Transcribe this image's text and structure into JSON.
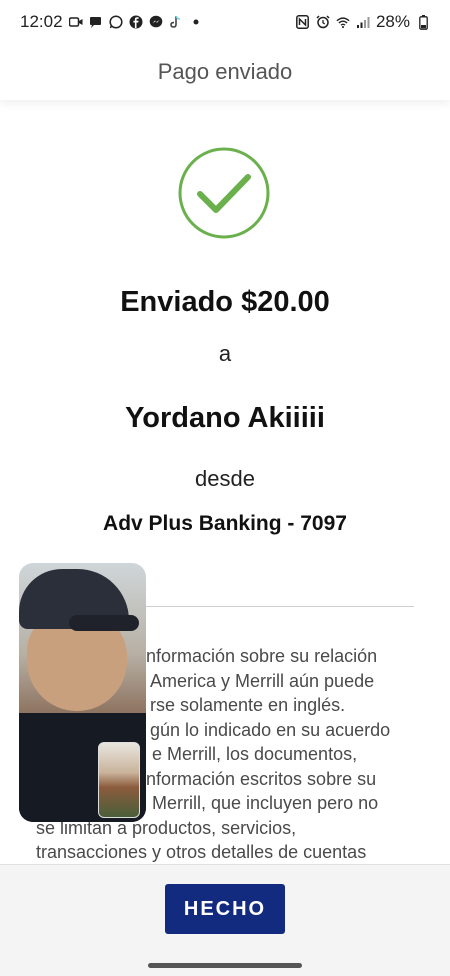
{
  "status_bar": {
    "time": "12:02",
    "battery": "28%",
    "left_icons": [
      "video-icon",
      "message-icon",
      "whatsapp-icon",
      "facebook-icon",
      "messenger-icon",
      "tiktok-icon",
      "dot-icon"
    ],
    "right_icons": [
      "nfc-icon",
      "alarm-icon",
      "wifi-icon",
      "signal-icon",
      "battery-icon"
    ]
  },
  "header": {
    "title": "Pago enviado"
  },
  "confirmation": {
    "icon": "checkmark-circle-icon",
    "accent_color": "#6ab04c",
    "amount_text": "Enviado $20.00",
    "to_word": "a",
    "recipient": "Yordano Akiiiii",
    "from_word": "desde",
    "account": "Adv Plus Banking - 7097"
  },
  "disclaimer": {
    "lines": [
      "nformación sobre su relación",
      "America y Merrill aún puede",
      "rse solamente en inglés.",
      "gún lo indicado en su acuerdo",
      "e Merrill, los documentos,",
      "nformación escritos sobre su",
      "Merrill, que incluyen pero no",
      "se limitan a productos, servicios,",
      "transacciones y otros detalles de cuentas"
    ]
  },
  "footer": {
    "done_label": "HECHO",
    "button_color": "#132b7f"
  },
  "video_overlay": {
    "type": "picture-in-picture video call"
  }
}
